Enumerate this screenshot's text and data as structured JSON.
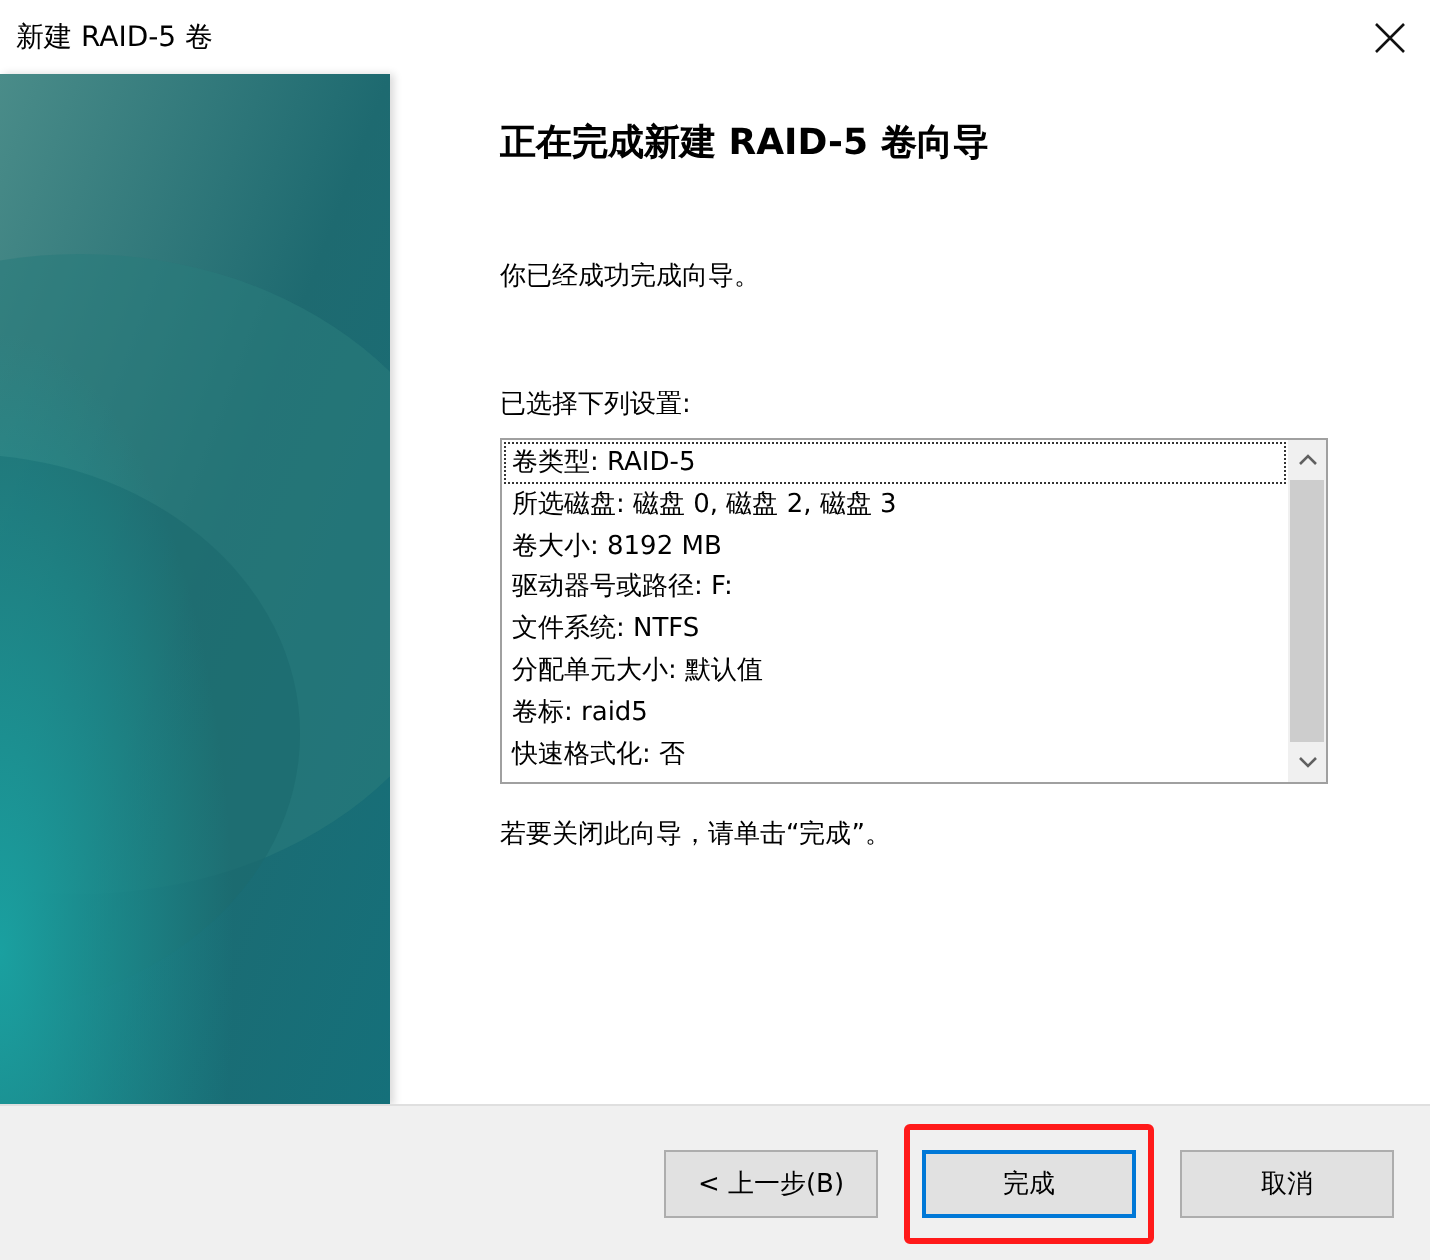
{
  "window": {
    "title": "新建 RAID-5 卷"
  },
  "heading": "正在完成新建 RAID-5 卷向导",
  "intro": "你已经成功完成向导。",
  "settings_label": "已选择下列设置:",
  "settings": [
    {
      "text": "卷类型: RAID-5",
      "focused": true
    },
    {
      "text": "所选磁盘: 磁盘 0, 磁盘 2, 磁盘 3",
      "focused": false
    },
    {
      "text": "卷大小: 8192 MB",
      "focused": false
    },
    {
      "text": "驱动器号或路径: F:",
      "focused": false
    },
    {
      "text": "文件系统: NTFS",
      "focused": false
    },
    {
      "text": "分配单元大小: 默认值",
      "focused": false
    },
    {
      "text": "卷标: raid5",
      "focused": false
    },
    {
      "text": "快速格式化: 否",
      "focused": false
    }
  ],
  "hint": "若要关闭此向导，请单击“完成”。",
  "buttons": [
    {
      "label": "< 上一步(B)",
      "default": false,
      "highlighted": false
    },
    {
      "label": "完成",
      "default": true,
      "highlighted": true
    },
    {
      "label": "取消",
      "default": false,
      "highlighted": false
    }
  ]
}
